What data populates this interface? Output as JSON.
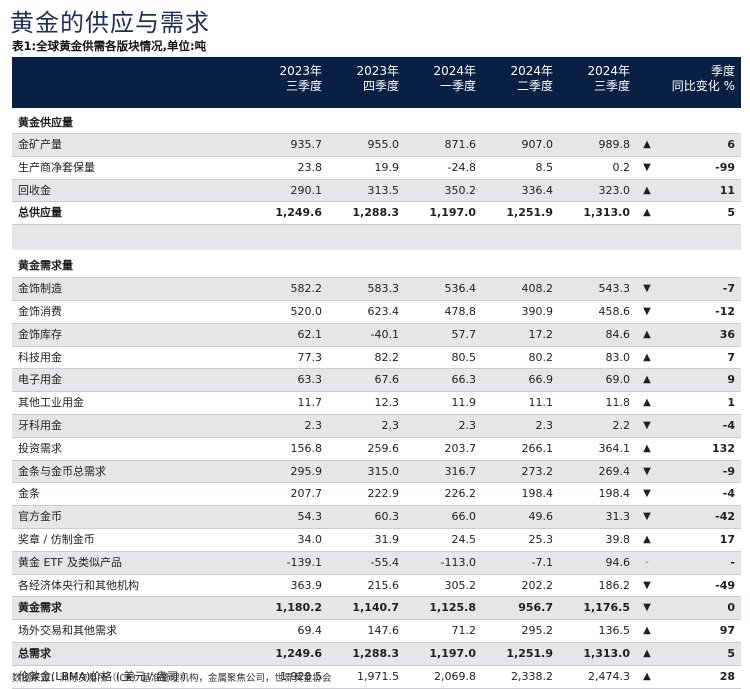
{
  "title": "黄金的供应与需求",
  "caption": "表1:全球黄金供需各版块情况,单位:吨",
  "headers": {
    "cols": [
      [
        "2023年",
        "三季度"
      ],
      [
        "2023年",
        "四季度"
      ],
      [
        "2024年",
        "一季度"
      ],
      [
        "2024年",
        "二季度"
      ],
      [
        "2024年",
        "三季度"
      ]
    ],
    "change": [
      "季度",
      "同比变化 %"
    ]
  },
  "sections": {
    "supply": "黄金供应量",
    "demand": "黄金需求量"
  },
  "supply_rows": [
    {
      "label": "金矿产量",
      "values": [
        "935.7",
        "955.0",
        "871.6",
        "907.0",
        "989.8"
      ],
      "arrow": "up",
      "change": "6"
    },
    {
      "label": "生产商净套保量",
      "values": [
        "23.8",
        "19.9",
        "-24.8",
        "8.5",
        "0.2"
      ],
      "arrow": "down",
      "change": "-99"
    },
    {
      "label": "回收金",
      "values": [
        "290.1",
        "313.5",
        "350.2",
        "336.4",
        "323.0"
      ],
      "arrow": "up",
      "change": "11"
    },
    {
      "label": "总供应量",
      "values": [
        "1,249.6",
        "1,288.3",
        "1,197.0",
        "1,251.9",
        "1,313.0"
      ],
      "arrow": "up",
      "change": "5",
      "bold": true
    }
  ],
  "demand_rows": [
    {
      "label": "金饰制造",
      "values": [
        "582.2",
        "583.3",
        "536.4",
        "408.2",
        "543.3"
      ],
      "arrow": "down",
      "change": "-7"
    },
    {
      "label": "金饰消费",
      "values": [
        "520.0",
        "623.4",
        "478.8",
        "390.9",
        "458.6"
      ],
      "arrow": "down",
      "change": "-12"
    },
    {
      "label": "金饰库存",
      "values": [
        "62.1",
        "-40.1",
        "57.7",
        "17.2",
        "84.6"
      ],
      "arrow": "up",
      "change": "36"
    },
    {
      "label": "科技用金",
      "values": [
        "77.3",
        "82.2",
        "80.5",
        "80.2",
        "83.0"
      ],
      "arrow": "up",
      "change": "7"
    },
    {
      "label": "电子用金",
      "values": [
        "63.3",
        "67.6",
        "66.3",
        "66.9",
        "69.0"
      ],
      "arrow": "up",
      "change": "9"
    },
    {
      "label": "其他工业用金",
      "values": [
        "11.7",
        "12.3",
        "11.9",
        "11.1",
        "11.8"
      ],
      "arrow": "up",
      "change": "1"
    },
    {
      "label": "牙科用金",
      "values": [
        "2.3",
        "2.3",
        "2.3",
        "2.3",
        "2.2"
      ],
      "arrow": "down",
      "change": "-4"
    },
    {
      "label": "投资需求",
      "values": [
        "156.8",
        "259.6",
        "203.7",
        "266.1",
        "364.1"
      ],
      "arrow": "up",
      "change": "132"
    },
    {
      "label": "金条与金币总需求",
      "values": [
        "295.9",
        "315.0",
        "316.7",
        "273.2",
        "269.4"
      ],
      "arrow": "down",
      "change": "-9"
    },
    {
      "label": "金条",
      "values": [
        "207.7",
        "222.9",
        "226.2",
        "198.4",
        "198.4"
      ],
      "arrow": "down",
      "change": "-4"
    },
    {
      "label": "官方金币",
      "values": [
        "54.3",
        "60.3",
        "66.0",
        "49.6",
        "31.3"
      ],
      "arrow": "down",
      "change": "-42"
    },
    {
      "label": "奖章 / 仿制金币",
      "values": [
        "34.0",
        "31.9",
        "24.5",
        "25.3",
        "39.8"
      ],
      "arrow": "up",
      "change": "17"
    },
    {
      "label": "黄金 ETF 及类似产品",
      "values": [
        "-139.1",
        "-55.4",
        "-113.0",
        "-7.1",
        "94.6"
      ],
      "arrow": "dash",
      "change": "-"
    },
    {
      "label": "各经济体央行和其他机构",
      "values": [
        "363.9",
        "215.6",
        "305.2",
        "202.2",
        "186.2"
      ],
      "arrow": "down",
      "change": "-49"
    },
    {
      "label": "黄金需求",
      "values": [
        "1,180.2",
        "1,140.7",
        "1,125.8",
        "956.7",
        "1,176.5"
      ],
      "arrow": "down",
      "change": "0",
      "bold": true
    },
    {
      "label": "场外交易和其他需求",
      "values": [
        "69.4",
        "147.6",
        "71.2",
        "295.2",
        "136.5"
      ],
      "arrow": "up",
      "change": "97"
    },
    {
      "label": "总需求",
      "values": [
        "1,249.6",
        "1,288.3",
        "1,197.0",
        "1,251.9",
        "1,313.0"
      ],
      "arrow": "up",
      "change": "5",
      "bold": true
    },
    {
      "label": "伦敦金(LBMA)价格 ( 美元 / 盎司 )",
      "values": [
        "1,928.5",
        "1,971.5",
        "2,069.8",
        "2,338.2",
        "2,474.3"
      ],
      "arrow": "up",
      "change": "28"
    }
  ],
  "arrow_glyphs": {
    "up": "▲",
    "down": "▼",
    "dash": "-"
  },
  "source": "数据来源：洲际交易所（ICE）基准管理机构，金属聚焦公司，世界黄金协会",
  "colors": {
    "header_bg": "#0a1f44",
    "title": "#1d2f57",
    "shade": "#e5e6e8"
  }
}
